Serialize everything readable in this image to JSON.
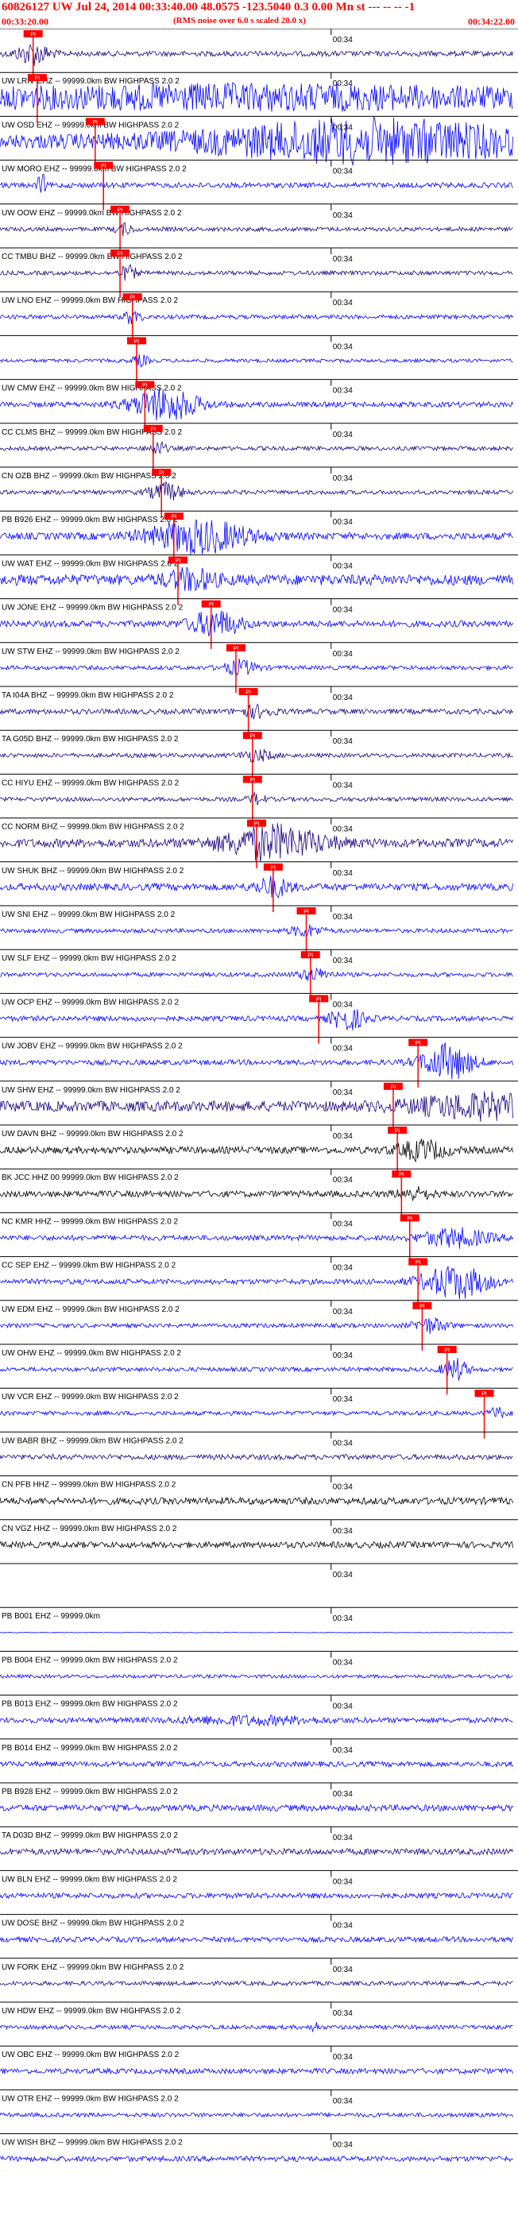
{
  "header": {
    "title": "60826127 UW Jul 24, 2014 00:33:40.00   48.0575 -123.5040  0.3 0.00 Mn st --- -- --  -1",
    "start_time": "00:33:20.00",
    "subtitle": "(RMS noise over 6.0 s scaled 20.0 x)",
    "end_time": "00:34:22.00"
  },
  "colors": {
    "red_marker": "#ff0000",
    "trace_blue": "#0000ff",
    "trace_navy": "#1a0080",
    "trace_black": "#000000",
    "text_red": "#ff0000"
  },
  "chart_data": {
    "type": "line",
    "title": "60826127 UW Jul 24, 2014 00:33:40.00   48.0575 -123.5040  0.3 0.00 Mn st --- -- --  -1",
    "xlim": [
      "00:33:20.00",
      "00:34:22.00"
    ],
    "minute_tick_label": "00:34",
    "minute_tick_time_s": 40,
    "traces": [
      {
        "label": "",
        "color": "navy",
        "amp": 0.15,
        "burst_t": 4,
        "burst_amp": 0.6,
        "burst_width": 2,
        "pick": "PI",
        "pick_t": 4
      },
      {
        "label": "UW LRIV EHZ -- 99999.0km BW HIGHPASS 2.0 2",
        "color": "blue",
        "amp": 0.55,
        "burst_t": 30,
        "burst_amp": 0.3,
        "burst_width": 30,
        "pick": "PI",
        "pick_t": 4.5
      },
      {
        "label": "UW OSD EHZ -- 99999.0km BW HIGHPASS 2.0 2",
        "color": "blue",
        "amp": 0.4,
        "burst_t": 45,
        "burst_amp": 1,
        "burst_width": 20,
        "pick": "PI",
        "pick_t": 11.5
      },
      {
        "label": "UW MORO EHZ -- 99999.0km BW HIGHPASS 2.0 2",
        "color": "blue",
        "amp": 0.15,
        "burst_t": 5,
        "burst_amp": 0.8,
        "burst_width": 0.4,
        "pick": "PI",
        "pick_t": 12.5
      },
      {
        "label": "UW OOW EHZ -- 99999.0km BW HIGHPASS 2.0 2",
        "color": "navy",
        "amp": 0.12,
        "burst_t": 15,
        "burst_amp": 0.3,
        "burst_width": 1,
        "pick": "PI",
        "pick_t": 14.5
      },
      {
        "label": "CC TMBU BHZ -- 99999.0km BW HIGHPASS 2.0 2",
        "color": "navy",
        "amp": 0.12,
        "burst_t": 15.5,
        "burst_amp": 0.4,
        "burst_width": 1,
        "pick": "PI",
        "pick_t": 14.5
      },
      {
        "label": "UW LNO EHZ -- 99999.0km BW HIGHPASS 2.0 2",
        "color": "blue",
        "amp": 0.12,
        "burst_t": 16,
        "burst_amp": 0.4,
        "burst_width": 1,
        "pick": "PI",
        "pick_t": 16
      },
      {
        "label": "",
        "color": "blue",
        "amp": 0.1,
        "burst_t": 17,
        "burst_amp": 0.3,
        "burst_width": 1,
        "pick": "PI",
        "pick_t": 16.5
      },
      {
        "label": "UW CMW EHZ -- 99999.0km BW HIGHPASS 2.0 2",
        "color": "blue",
        "amp": 0.15,
        "burst_t": 20,
        "burst_amp": 0.9,
        "burst_width": 4,
        "pick": "PI",
        "pick_t": 17.5
      },
      {
        "label": "CC CLMS BHZ -- 99999.0km BW HIGHPASS 2.0 2",
        "color": "navy",
        "amp": 0.12,
        "burst_t": 19,
        "burst_amp": 0.4,
        "burst_width": 1,
        "pick": "PI",
        "pick_t": 18.5
      },
      {
        "label": "CN OZB BHZ -- 99999.0km BW HIGHPASS 2.0 2",
        "color": "navy",
        "amp": 0.12,
        "burst_t": 20,
        "burst_amp": 0.5,
        "burst_width": 2,
        "pick": "PI",
        "pick_t": 19.5
      },
      {
        "label": "PB B926 EHZ -- 99999.0km BW HIGHPASS 2.0 2",
        "color": "blue",
        "amp": 0.2,
        "burst_t": 24,
        "burst_amp": 0.9,
        "burst_width": 6,
        "pick": "PI",
        "pick_t": 21
      },
      {
        "label": "UW WAT EHZ -- 99999.0km BW HIGHPASS 2.0 2",
        "color": "blue",
        "amp": 0.3,
        "burst_t": 23,
        "burst_amp": 0.5,
        "burst_width": 3,
        "pick": "PI",
        "pick_t": 21.5
      },
      {
        "label": "UW JONE EHZ -- 99999.0km BW HIGHPASS 2.0 2",
        "color": "blue",
        "amp": 0.18,
        "burst_t": 26,
        "burst_amp": 0.7,
        "burst_width": 3,
        "pick": "PI",
        "pick_t": 25.5
      },
      {
        "label": "UW STW EHZ -- 99999.0km BW HIGHPASS 2.0 2",
        "color": "blue",
        "amp": 0.12,
        "burst_t": 29,
        "burst_amp": 0.4,
        "burst_width": 2,
        "pick": "PI",
        "pick_t": 28.5
      },
      {
        "label": "TA I04A BHZ -- 99999.0km BW HIGHPASS 2.0 2",
        "color": "navy",
        "amp": 0.15,
        "burst_t": 31,
        "burst_amp": 0.3,
        "burst_width": 2,
        "pick": "PI",
        "pick_t": 30
      },
      {
        "label": "TA G05D BHZ -- 99999.0km BW HIGHPASS 2.0 2",
        "color": "navy",
        "amp": 0.12,
        "burst_t": 31,
        "burst_amp": 0.3,
        "burst_width": 2,
        "pick": "PI",
        "pick_t": 30.5
      },
      {
        "label": "CC HIYU EHZ -- 99999.0km BW HIGHPASS 2.0 2",
        "color": "navy",
        "amp": 0.12,
        "burst_t": 31,
        "burst_amp": 0.3,
        "burst_width": 1,
        "pick": "PI",
        "pick_t": 30.5
      },
      {
        "label": "CC NORM BHZ -- 99999.0km BW HIGHPASS 2.0 2",
        "color": "navy",
        "amp": 0.25,
        "burst_t": 33,
        "burst_amp": 0.9,
        "burst_width": 6,
        "pick": "PI",
        "pick_t": 31
      },
      {
        "label": "UW SHUK BHZ -- 99999.0km BW HIGHPASS 2.0 2",
        "color": "blue",
        "amp": 0.2,
        "burst_t": 33,
        "burst_amp": 0.5,
        "burst_width": 2,
        "pick": "PI",
        "pick_t": 33
      },
      {
        "label": "UW SNI EHZ -- 99999.0km BW HIGHPASS 2.0 2",
        "color": "blue",
        "amp": 0.12,
        "burst_t": 37,
        "burst_amp": 0.3,
        "burst_width": 2,
        "pick": "PI",
        "pick_t": 37
      },
      {
        "label": "UW SLF EHZ -- 99999.0km BW HIGHPASS 2.0 2",
        "color": "blue",
        "amp": 0.12,
        "burst_t": 38,
        "burst_amp": 0.3,
        "burst_width": 2,
        "pick": "PI",
        "pick_t": 37.5
      },
      {
        "label": "UW OCP EHZ -- 99999.0km BW HIGHPASS 2.0 2",
        "color": "blue",
        "amp": 0.15,
        "burst_t": 42,
        "burst_amp": 0.6,
        "burst_width": 2,
        "pick": "PI",
        "pick_t": 38.5
      },
      {
        "label": "UW JOBV EHZ -- 99999.0km BW HIGHPASS 2.0 2",
        "color": "blue",
        "amp": 0.15,
        "burst_t": 54,
        "burst_amp": 1,
        "burst_width": 3,
        "pick": "PI",
        "pick_t": 50.5
      },
      {
        "label": "UW SHW EHZ -- 99999.0km BW HIGHPASS 2.0 2",
        "color": "navy",
        "amp": 0.3,
        "burst_t": 58,
        "burst_amp": 0.6,
        "burst_width": 8,
        "pick": "PI",
        "pick_t": 47.5
      },
      {
        "label": "UW DAVN BHZ -- 99999.0km BW HIGHPASS 2.0 2",
        "color": "black",
        "amp": 0.2,
        "burst_t": 51,
        "burst_amp": 0.5,
        "burst_width": 3,
        "pick": "PI",
        "pick_t": 48
      },
      {
        "label": "BK JCC HHZ 00 99999.0km BW HIGHPASS 2.0 2",
        "color": "black",
        "amp": 0.18,
        "burst_t": 50,
        "burst_amp": 0.3,
        "burst_width": 2,
        "pick": "PI",
        "pick_t": 48.5
      },
      {
        "label": "NC KMR HHZ -- 99999.0km BW HIGHPASS 2.0 2",
        "color": "blue",
        "amp": 0.15,
        "burst_t": 55,
        "burst_amp": 0.5,
        "burst_width": 4,
        "pick": "PI",
        "pick_t": 49.5
      },
      {
        "label": "CC SEP EHZ -- 99999.0km BW HIGHPASS 2.0 2",
        "color": "blue",
        "amp": 0.15,
        "burst_t": 55,
        "burst_amp": 0.9,
        "burst_width": 4,
        "pick": "PI",
        "pick_t": 50.5
      },
      {
        "label": "UW EDM EHZ -- 99999.0km BW HIGHPASS 2.0 2",
        "color": "blue",
        "amp": 0.12,
        "burst_t": 52,
        "burst_amp": 0.4,
        "burst_width": 2,
        "pick": "PI",
        "pick_t": 51
      },
      {
        "label": "UW OHW EHZ -- 99999.0km BW HIGHPASS 2.0 2",
        "color": "blue",
        "amp": 0.12,
        "burst_t": 55,
        "burst_amp": 0.6,
        "burst_width": 1.5,
        "pick": "PI",
        "pick_t": 54
      },
      {
        "label": "UW VCR EHZ -- 99999.0km BW HIGHPASS 2.0 2",
        "color": "blue",
        "amp": 0.12,
        "burst_t": 60,
        "burst_amp": 0.3,
        "burst_width": 1,
        "pick": "PI",
        "pick_t": 58.5
      },
      {
        "label": "UW BABR BHZ -- 99999.0km BW HIGHPASS 2.0 2",
        "color": "navy",
        "amp": 0.15,
        "burst_t": 0,
        "burst_amp": 0,
        "burst_width": 1,
        "pick": "",
        "pick_t": null
      },
      {
        "label": "CN PFB HHZ -- 99999.0km BW HIGHPASS 2.0 2",
        "color": "black",
        "amp": 0.2,
        "burst_t": 0,
        "burst_amp": 0,
        "burst_width": 1,
        "pick": "",
        "pick_t": null
      },
      {
        "label": "CN VGZ HHZ -- 99999.0km BW HIGHPASS 2.0 2",
        "color": "black",
        "amp": 0.18,
        "burst_t": 0,
        "burst_amp": 0,
        "burst_width": 1,
        "pick": "",
        "pick_t": null
      },
      {
        "label": "",
        "color": "none",
        "amp": 0,
        "burst_t": 0,
        "burst_amp": 0,
        "burst_width": 1,
        "pick": "",
        "pick_t": null
      },
      {
        "label": "PB B001 EHZ -- 99999.0km",
        "color": "blue",
        "amp": 0.02,
        "burst_t": 0,
        "burst_amp": 0,
        "burst_width": 1,
        "pick": "",
        "pick_t": null
      },
      {
        "label": "PB B004 EHZ -- 99999.0km BW HIGHPASS 2.0 2",
        "color": "blue",
        "amp": 0.1,
        "burst_t": 0,
        "burst_amp": 0,
        "burst_width": 1,
        "pick": "",
        "pick_t": null
      },
      {
        "label": "PB B013 EHZ -- 99999.0km BW HIGHPASS 2.0 2",
        "color": "blue",
        "amp": 0.15,
        "burst_t": 30,
        "burst_amp": 0.2,
        "burst_width": 8,
        "pick": "",
        "pick_t": null
      },
      {
        "label": "PB B014 EHZ -- 99999.0km BW HIGHPASS 2.0 2",
        "color": "blue",
        "amp": 0.15,
        "burst_t": 0,
        "burst_amp": 0,
        "burst_width": 1,
        "pick": "",
        "pick_t": null
      },
      {
        "label": "PB B928 EHZ -- 99999.0km BW HIGHPASS 2.0 2",
        "color": "blue",
        "amp": 0.18,
        "burst_t": 0,
        "burst_amp": 0,
        "burst_width": 1,
        "pick": "",
        "pick_t": null
      },
      {
        "label": "TA D03D BHZ -- 99999.0km BW HIGHPASS 2.0 2",
        "color": "navy",
        "amp": 0.18,
        "burst_t": 0,
        "burst_amp": 0,
        "burst_width": 1,
        "pick": "",
        "pick_t": null
      },
      {
        "label": "UW BLN EHZ -- 99999.0km BW HIGHPASS 2.0 2",
        "color": "blue",
        "amp": 0.15,
        "burst_t": 0,
        "burst_amp": 0,
        "burst_width": 1,
        "pick": "",
        "pick_t": null
      },
      {
        "label": "UW DOSE BHZ -- 99999.0km BW HIGHPASS 2.0 2",
        "color": "blue",
        "amp": 0.15,
        "burst_t": 0,
        "burst_amp": 0,
        "burst_width": 1,
        "pick": "",
        "pick_t": null
      },
      {
        "label": "UW FORK EHZ -- 99999.0km BW HIGHPASS 2.0 2",
        "color": "navy",
        "amp": 0.12,
        "burst_t": 0,
        "burst_amp": 0,
        "burst_width": 1,
        "pick": "",
        "pick_t": null
      },
      {
        "label": "UW HDW EHZ -- 99999.0km BW HIGHPASS 2.0 2",
        "color": "blue",
        "amp": 0.12,
        "burst_t": 38,
        "burst_amp": 0.6,
        "burst_width": 0.3,
        "pick": "",
        "pick_t": null
      },
      {
        "label": "UW OBC EHZ -- 99999.0km BW HIGHPASS 2.0 2",
        "color": "blue",
        "amp": 0.15,
        "burst_t": 0,
        "burst_amp": 0,
        "burst_width": 1,
        "pick": "",
        "pick_t": null
      },
      {
        "label": "UW OTR EHZ -- 99999.0km BW HIGHPASS 2.0 2",
        "color": "blue",
        "amp": 0.12,
        "burst_t": 0,
        "burst_amp": 0,
        "burst_width": 1,
        "pick": "",
        "pick_t": null
      },
      {
        "label": "UW WISH BHZ -- 99999.0km BW HIGHPASS 2.0 2",
        "color": "blue",
        "amp": 0.15,
        "burst_t": 0,
        "burst_amp": 0,
        "burst_width": 1,
        "pick": "",
        "pick_t": null
      }
    ]
  }
}
